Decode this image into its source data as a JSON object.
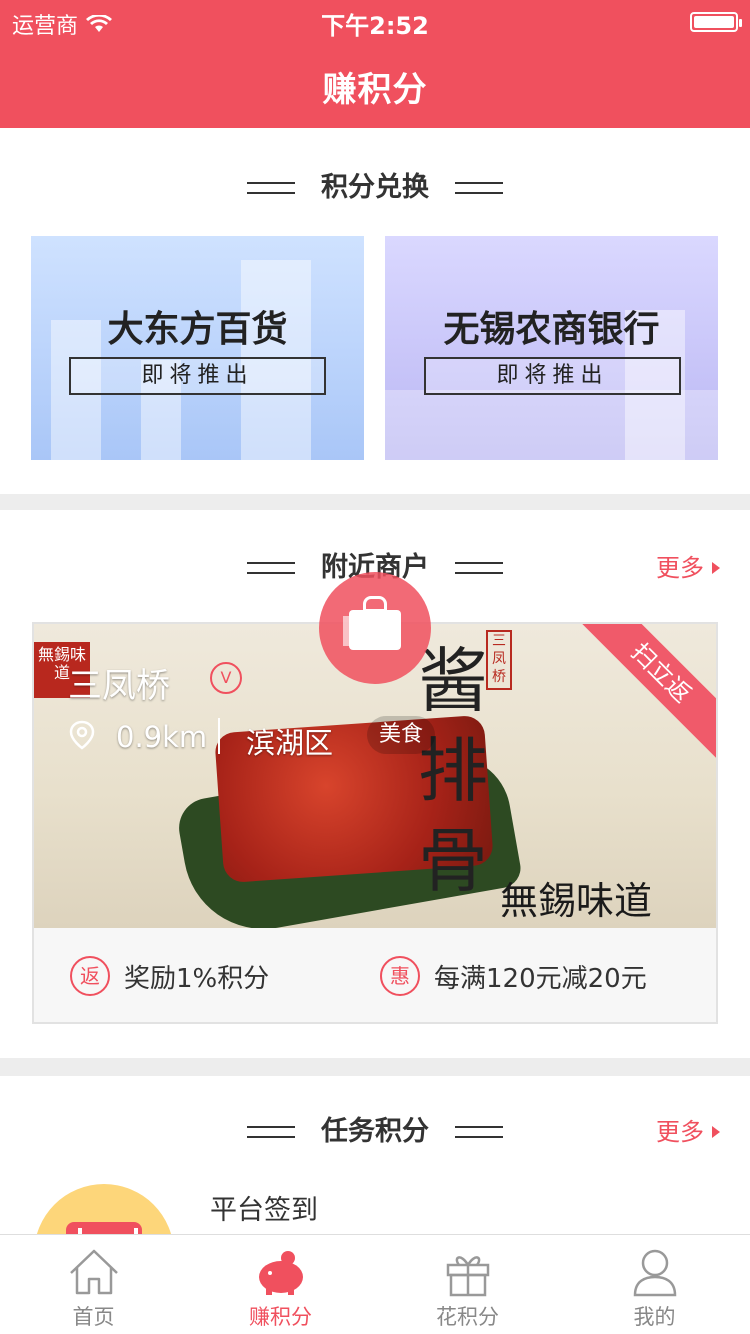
{
  "status_bar": {
    "carrier": "运营商",
    "time": "下午2:52"
  },
  "header": {
    "title": "赚积分"
  },
  "exchange": {
    "title": "积分兑换",
    "cards": [
      {
        "name": "大东方百货",
        "badge": "即将推出"
      },
      {
        "name": "无锡农商银行",
        "badge": "即将推出"
      }
    ]
  },
  "nearby": {
    "title": "附近商户",
    "more": "更多",
    "merchant": {
      "name": "三凤桥",
      "distance": "0.9km",
      "area": "滨湖区",
      "tag": "美食",
      "ribbon": "扫立返",
      "image_text": {
        "calligraphy": "酱排骨",
        "subtitle": "無錫味道",
        "stamp": "三凤桥",
        "side_stamp": "無錫味道"
      },
      "perks": [
        {
          "icon_text": "返",
          "label": "奖励1%积分"
        },
        {
          "icon_text": "惠",
          "label": "每满120元减20元"
        }
      ]
    }
  },
  "tasks": {
    "title": "任务积分",
    "more": "更多",
    "items": [
      {
        "name": "平台签到"
      }
    ]
  },
  "tabbar": {
    "items": [
      {
        "label": "首页",
        "icon": "home-icon"
      },
      {
        "label": "赚积分",
        "icon": "piggy-bank-icon"
      },
      {
        "label": "花积分",
        "icon": "gift-icon"
      },
      {
        "label": "我的",
        "icon": "user-icon"
      }
    ],
    "active_index": 1
  },
  "colors": {
    "accent": "#f0505e",
    "text": "#333333",
    "muted": "#888888"
  }
}
